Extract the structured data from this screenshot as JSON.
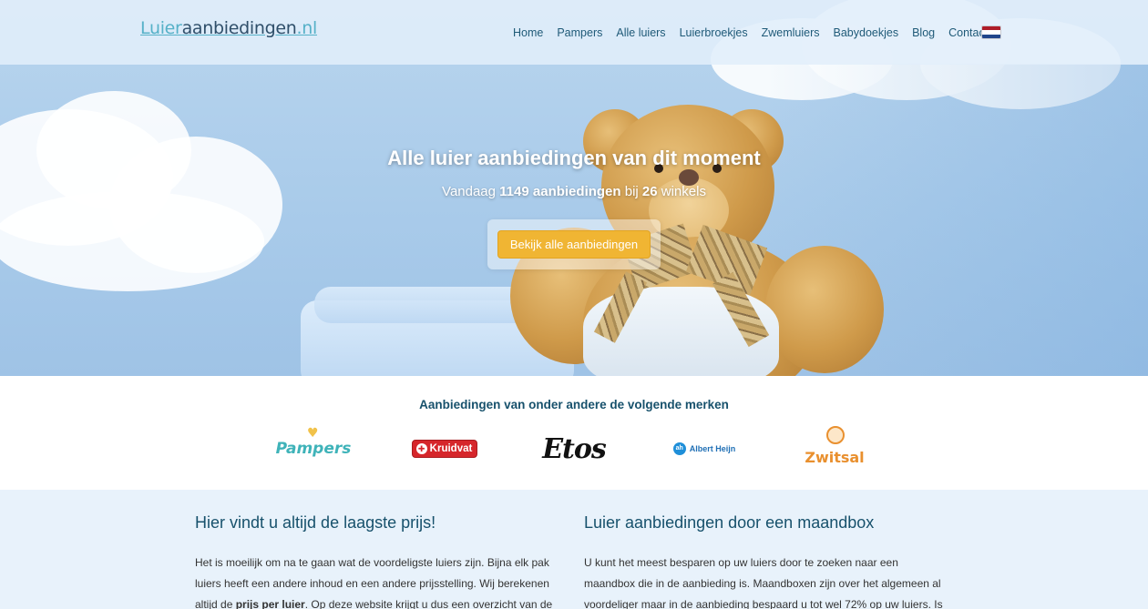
{
  "header": {
    "logo": {
      "part1": "Luier",
      "part2": "aanbiedingen",
      "part3": ".nl"
    },
    "nav": [
      "Home",
      "Pampers",
      "Alle luiers",
      "Luierbroekjes",
      "Zwemluiers",
      "Babydoekjes",
      "Blog",
      "Contact"
    ],
    "language_flag": "netherlands-flag-icon"
  },
  "hero": {
    "title": "Alle luier aanbiedingen van dit moment",
    "subtitle_pre": "Vandaag ",
    "offer_count": "1149 aanbiedingen",
    "subtitle_mid": " bij ",
    "shop_count": "26",
    "subtitle_post": " winkels",
    "cta_label": "Bekijk alle aanbiedingen"
  },
  "brands": {
    "title": "Aanbiedingen van onder andere de volgende merken",
    "items": [
      {
        "name": "Pampers",
        "icon": "pampers-logo"
      },
      {
        "name": "Kruidvat",
        "icon": "kruidvat-logo"
      },
      {
        "name": "Etos",
        "icon": "etos-logo"
      },
      {
        "name": "Albert Heijn",
        "icon": "albert-heijn-logo"
      },
      {
        "name": "Zwitsal",
        "icon": "zwitsal-logo"
      }
    ]
  },
  "content": {
    "left": {
      "heading": "Hier vindt u altijd de laagste prijs!",
      "text_1": "Het is moeilijk om na te gaan wat de voordeligste luiers zijn. Bijna elk pak luiers heeft een andere inhoud en een andere prijsstelling. Wij berekenen altijd de ",
      "bold": "prijs per luier",
      "text_2": ". Op deze website krijgt u dus een overzicht van de"
    },
    "right": {
      "heading": "Luier aanbiedingen door een maandbox",
      "text": "U kunt het meest besparen op uw luiers door te zoeken naar een maandbox die in de aanbieding is. Maandboxen zijn over het algemeen al voordeliger maar in de aanbieding bespaard u tot wel 72% op uw luiers. Is"
    }
  },
  "colors": {
    "nav_text": "#1f5a78",
    "cta": "#f0b533",
    "heading": "#17516c",
    "content_bg": "#e8f2fb"
  }
}
